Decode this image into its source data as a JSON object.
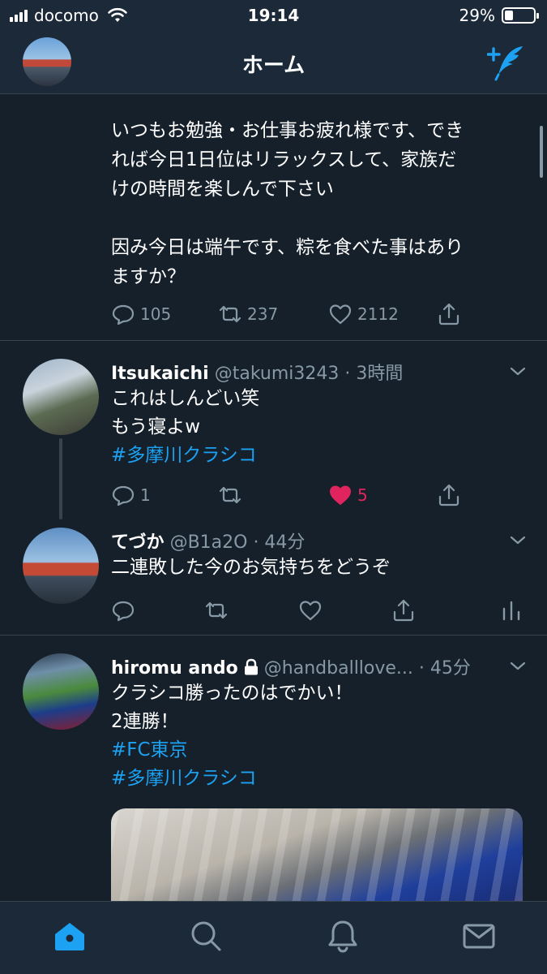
{
  "status_bar": {
    "carrier": "docomo",
    "time": "19:14",
    "battery": "29%",
    "battery_level": 0.29
  },
  "nav": {
    "title": "ホーム"
  },
  "tweets": [
    {
      "text": "いつもお勉強・お仕事お疲れ様です、でき\nれば今日1日位はリラックスして、家族だ\nけの時間を楽しんで下さい\n\n因み今日は端午です、粽を食べた事はあり\nますか？",
      "replies": "105",
      "retweets": "237",
      "likes": "2112"
    },
    {
      "name": "Itsukaichi",
      "handle": "@takumi3243 · 3時間",
      "lines": [
        "これはしんどい笑",
        "もう寝よw"
      ],
      "hashtags": [
        "#多摩川クラシコ"
      ],
      "replies": "1",
      "retweets": "",
      "likes": "5"
    },
    {
      "name": "てづか",
      "handle": "@B1a2O · 44分",
      "lines": [
        "二連敗した今のお気持ちをどうぞ"
      ]
    },
    {
      "name": "hiromu ando",
      "handle": "@handballlove... · 45分",
      "lines": [
        "クラシコ勝ったのはでかい！",
        "2連勝！"
      ],
      "hashtags": [
        "#FC東京",
        "#多摩川クラシコ"
      ]
    }
  ],
  "icons": {
    "compose": "compose-tweet-icon",
    "reply": "reply-icon",
    "retweet": "retweet-icon",
    "like": "heart-icon",
    "share": "share-icon",
    "analytics": "analytics-icon",
    "home": "home-icon",
    "search": "search-icon",
    "notifications": "bell-icon",
    "messages": "mail-icon"
  },
  "colors": {
    "background": "#15202b",
    "accent": "#1da1f2",
    "like": "#e0245e",
    "muted": "#8899a6"
  }
}
